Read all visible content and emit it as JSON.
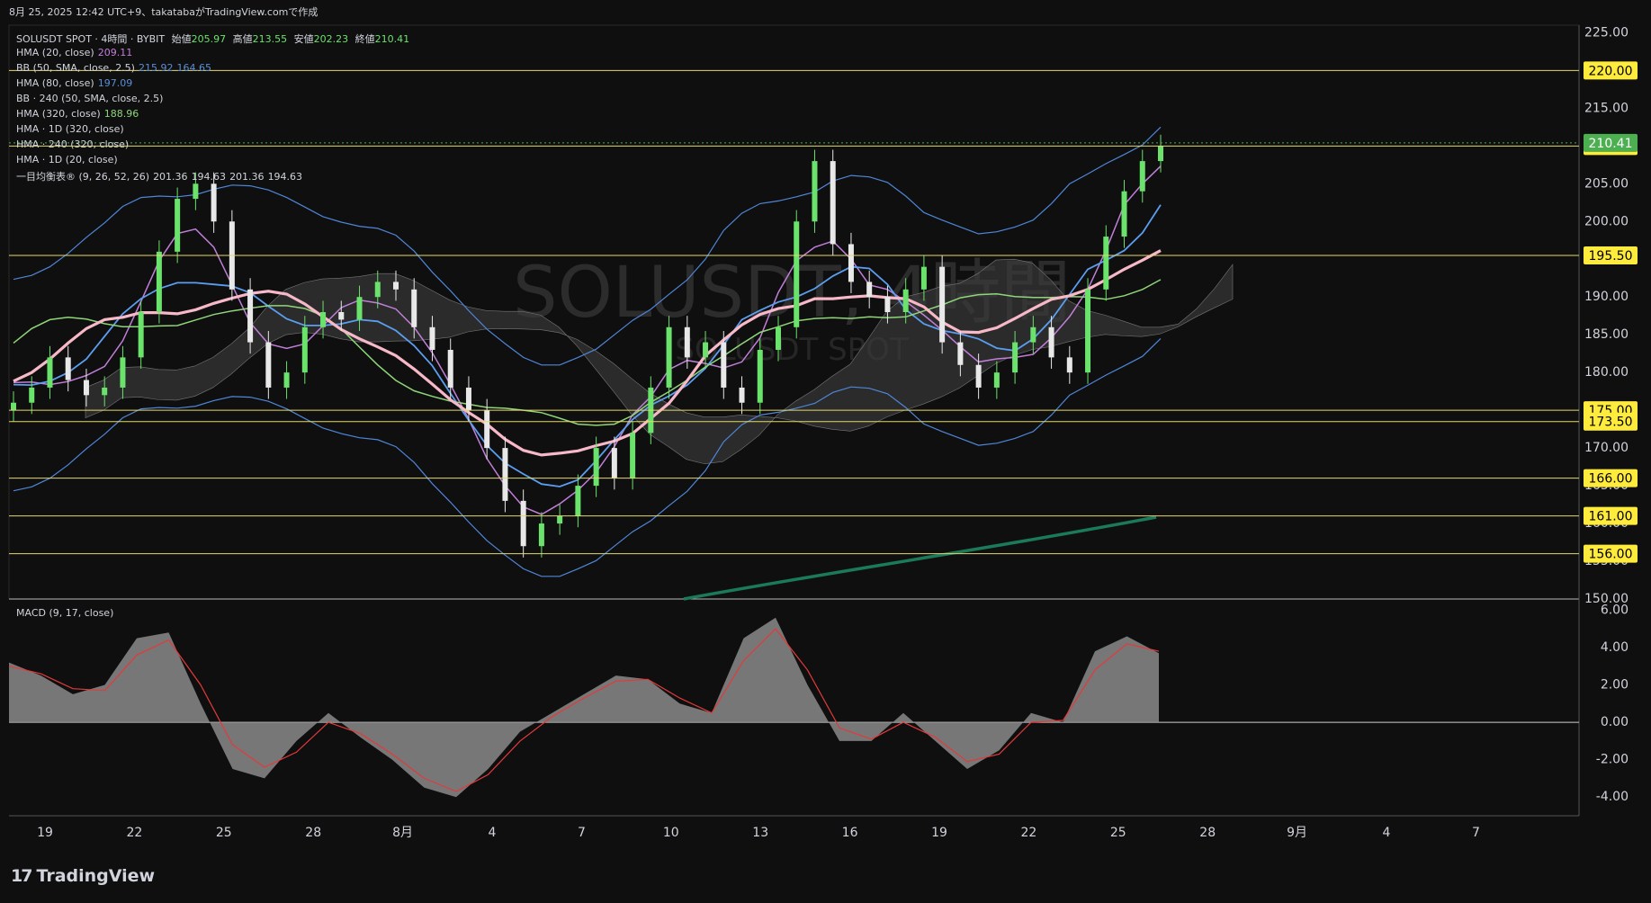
{
  "header": {
    "caption": "8月 25, 2025 12:42 UTC+9、takatabaがTradingView.comで作成"
  },
  "legend": {
    "symbol": "SOLUSDT SPOT · 4時間 · BYBIT",
    "ohlc": {
      "open_label": "始値",
      "open": "205.97",
      "high_label": "高値",
      "high": "213.55",
      "low_label": "安値",
      "low": "202.23",
      "close_label": "終値",
      "close": "210.41"
    },
    "indicators": [
      {
        "name": "HMA (20, close)",
        "values": [
          "209.11"
        ],
        "color": "#c17fd8"
      },
      {
        "name": "BB (50, SMA, close, 2.5)",
        "values": [
          "215.92",
          "164.65"
        ],
        "color": "#5b8fd6"
      },
      {
        "name": "HMA (80, close)",
        "values": [
          "197.09"
        ],
        "color": "#5b8fd6"
      },
      {
        "name": "BB · 240 (50, SMA, close, 2.5)",
        "values": [],
        "color": "#d1d4dc"
      },
      {
        "name": "HMA (320, close)",
        "values": [
          "188.96"
        ],
        "color": "#8fd67a"
      },
      {
        "name": "HMA · 1D (320, close)",
        "values": [],
        "color": "#d1d4dc"
      },
      {
        "name": "HMA · 240 (320, close)",
        "values": [],
        "color": "#d1d4dc"
      },
      {
        "name": "HMA · 1D (20, close)",
        "values": [],
        "color": "#d1d4dc"
      },
      {
        "name": "一目均衡表® (9, 26, 52, 26)",
        "values": [
          "201.36",
          "194.63",
          "201.36",
          "194.63"
        ],
        "color": "#d1d4dc"
      }
    ]
  },
  "watermark": {
    "main": "SOLUSDT, 4時間",
    "sub": "SOLUSDT SPOT"
  },
  "colors": {
    "background": "#0f0f0f",
    "up": "#6be26b",
    "down": "#e8e8e8",
    "hma20": "#c17fd8",
    "bb": "#4f86d8",
    "hma80": "#5b9ef0",
    "hma320": "#8fd67a",
    "hma1d": "#f7b8c8",
    "cloud": "#3a3a3a",
    "level": "#e6d96a",
    "yellow_tag": "#ffeb3b",
    "green_tag": "#4caf50",
    "macd": "#8a8a8a",
    "signal": "#e33a3a"
  },
  "macd_label": "MACD (9, 17, close)",
  "footer": {
    "brand": "TradingView"
  },
  "chart_data": [
    {
      "type": "candlestick",
      "title": "SOLUSDT SPOT · 4時間 · BYBIT",
      "y_axis": {
        "ticks": [
          "225.00",
          "220.00",
          "215.00",
          "210.00",
          "205.00",
          "200.00",
          "195.00",
          "190.00",
          "185.00",
          "180.00",
          "175.00",
          "170.00",
          "165.00",
          "160.00",
          "155.00",
          "150.00"
        ],
        "ylim": [
          150,
          226
        ]
      },
      "x_axis": {
        "ticks": [
          "19",
          "22",
          "25",
          "28",
          "8月",
          "4",
          "7",
          "10",
          "13",
          "16",
          "19",
          "22",
          "25",
          "28",
          "9月",
          "4",
          "7"
        ]
      },
      "horizontal_levels": [
        {
          "value": 220.0,
          "label": "220.00"
        },
        {
          "value": 210.0,
          "label": "210.00"
        },
        {
          "value": 195.5,
          "label": "195.50"
        },
        {
          "value": 175.0,
          "label": "175.00"
        },
        {
          "value": 173.5,
          "label": "173.50"
        },
        {
          "value": 166.0,
          "label": "166.00"
        },
        {
          "value": 161.0,
          "label": "161.00"
        },
        {
          "value": 156.0,
          "label": "156.00"
        }
      ],
      "last_price": {
        "value": 210.41,
        "label": "210.41"
      },
      "close_series": [
        176,
        178,
        182,
        179,
        177,
        178,
        182,
        188,
        196,
        203,
        205,
        200,
        191,
        184,
        178,
        180,
        186,
        188,
        187,
        190,
        192,
        191,
        186,
        183,
        178,
        175,
        170,
        163,
        157,
        160,
        161,
        165,
        170,
        166,
        172,
        178,
        186,
        182,
        184,
        178,
        176,
        183,
        186,
        200,
        208,
        197,
        192,
        190,
        188,
        191,
        194,
        184,
        181,
        178,
        180,
        184,
        186,
        182,
        180,
        191,
        198,
        204,
        208,
        210
      ]
    },
    {
      "type": "line",
      "title": "MACD (9, 17, close)",
      "y_axis": {
        "ticks": [
          "6.00",
          "4.00",
          "2.00",
          "0.00",
          "-2.00",
          "-4.00"
        ],
        "ylim": [
          -5,
          6.5
        ]
      },
      "series": [
        {
          "name": "MACD",
          "values": [
            3.2,
            2.5,
            1.5,
            2.0,
            4.5,
            4.8,
            1.0,
            -2.5,
            -3.0,
            -1.0,
            0.5,
            -0.8,
            -2.0,
            -3.5,
            -4.0,
            -2.5,
            -0.5,
            0.5,
            1.5,
            2.5,
            2.3,
            1.0,
            0.5,
            4.5,
            5.6,
            2.0,
            -1.0,
            -1.0,
            0.5,
            -1.0,
            -2.5,
            -1.5,
            0.5,
            0.0,
            3.8,
            4.6,
            3.7
          ]
        },
        {
          "name": "Signal",
          "values": [
            3.0,
            2.6,
            1.8,
            1.7,
            3.6,
            4.4,
            2.0,
            -1.2,
            -2.4,
            -1.6,
            0.0,
            -0.6,
            -1.7,
            -3.0,
            -3.7,
            -2.8,
            -1.0,
            0.3,
            1.3,
            2.2,
            2.3,
            1.3,
            0.5,
            3.3,
            5.0,
            2.8,
            -0.3,
            -0.9,
            0.0,
            -0.8,
            -2.1,
            -1.7,
            0.0,
            0.1,
            2.8,
            4.2,
            3.8
          ]
        }
      ]
    }
  ]
}
